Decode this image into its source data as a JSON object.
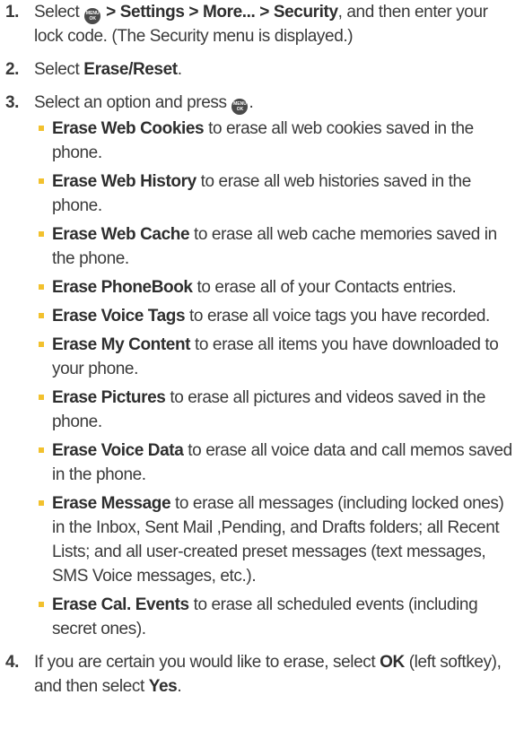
{
  "steps": [
    {
      "number": "1.",
      "parts": {
        "select": "Select ",
        "path": " > Settings > More... > Security",
        "rest": ", and then enter your lock code. (The Security menu is displayed.)"
      }
    },
    {
      "number": "2.",
      "parts": {
        "select": "Select ",
        "bold": "Erase/Reset",
        "rest": "."
      }
    },
    {
      "number": "3.",
      "parts": {
        "text": "Select an option and press ",
        "rest": "."
      }
    },
    {
      "number": "4.",
      "parts": {
        "pre": "If you are certain you would like to erase, select ",
        "ok": "OK",
        "mid": " (left softkey), and then select ",
        "yes": "Yes",
        "rest": "."
      }
    }
  ],
  "menu_key": {
    "top": "MENU",
    "bottom": "OK",
    "icon": "menu-ok-key-icon"
  },
  "options": [
    {
      "label": "Erase Web Cookies",
      "desc": " to erase all web cookies saved in the phone."
    },
    {
      "label": "Erase Web History",
      "desc": " to erase all web histories saved in the phone."
    },
    {
      "label": "Erase Web Cache",
      "desc": " to erase all web cache memories saved in the phone."
    },
    {
      "label": "Erase PhoneBook",
      "desc": " to erase all of your Contacts entries."
    },
    {
      "label": "Erase Voice Tags",
      "desc": " to erase all voice tags you have recorded."
    },
    {
      "label": "Erase My Content",
      "desc": " to erase all items you have downloaded to your phone."
    },
    {
      "label": "Erase Pictures",
      "desc": " to erase all pictures and videos saved in the phone."
    },
    {
      "label": "Erase Voice Data",
      "desc": " to erase all voice data and call memos saved in the phone."
    },
    {
      "label": "Erase Message",
      "desc": " to erase all messages (including locked ones) in the Inbox, Sent Mail ,Pending, and Drafts folders; all Recent Lists; and all user-created preset messages (text messages, SMS Voice messages, etc.)."
    },
    {
      "label": "Erase Cal. Events",
      "desc": " to erase all scheduled events (including secret ones)."
    }
  ],
  "colors": {
    "text": "#3a3a3a",
    "bullet": "#f2c12e",
    "key": "#4a4a4a"
  }
}
